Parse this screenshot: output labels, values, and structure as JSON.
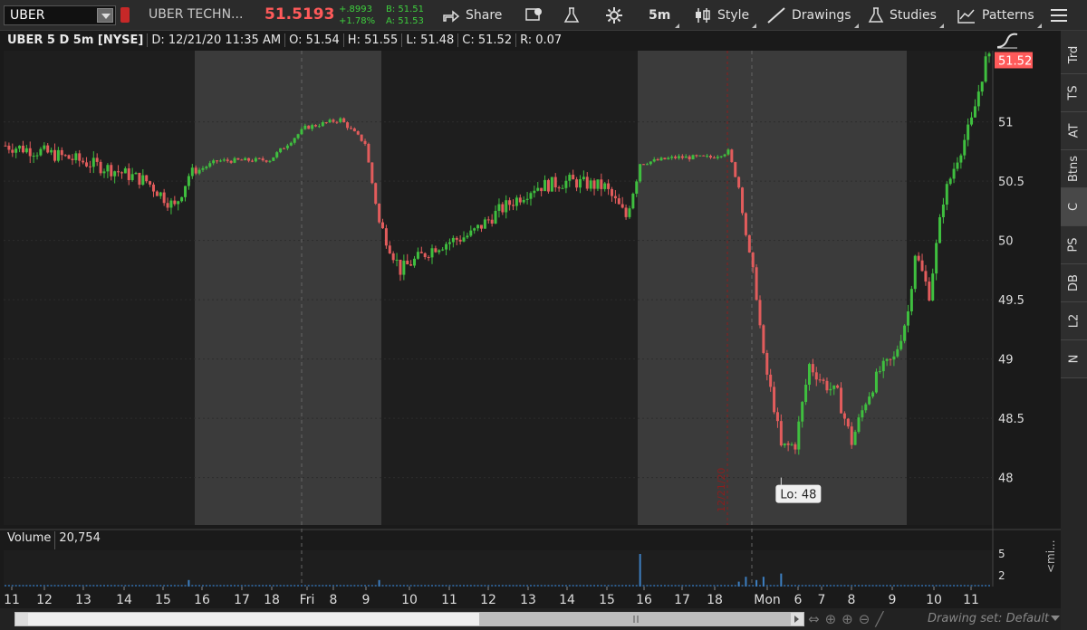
{
  "toolbar": {
    "symbol": "UBER",
    "company": "UBER TECHN...",
    "last_price": "51.5193",
    "net_change": "+.8993",
    "pct_change": "+1.78%",
    "bid": "B: 51.51",
    "ask": "A: 51.53",
    "share_label": "Share",
    "timeframe_label": "5m",
    "style_label": "Style",
    "drawings_label": "Drawings",
    "studies_label": "Studies",
    "patterns_label": "Patterns"
  },
  "infobar": {
    "title": "UBER 5 D 5m [NYSE]",
    "date": "D: 12/21/20 11:35 AM",
    "open": "O: 51.54",
    "high": "H: 51.55",
    "low": "L: 51.48",
    "close": "C: 51.52",
    "range": "R: 0.07"
  },
  "volume": {
    "label": "Volume",
    "value": "20,754",
    "axis_ticks": [
      "5",
      "2"
    ]
  },
  "right_tabs": [
    "Trd",
    "TS",
    "AT",
    "Btns",
    "C",
    "PS",
    "DB",
    "L2",
    "N"
  ],
  "mi_tab": "<mi...",
  "bottom": {
    "drawing_set": "Drawing set: Default"
  },
  "colors": {
    "up": "#3fbf3f",
    "down": "#e25c5c",
    "background": "#1a1a1a",
    "extended_hours": "#3b3b3b",
    "price_tag": "#ff5a5a"
  },
  "chart_data": {
    "type": "candlestick",
    "symbol": "UBER",
    "ylim": [
      47.6,
      51.6
    ],
    "y_ticks": [
      48,
      48.5,
      49,
      49.5,
      50,
      50.5,
      51
    ],
    "x_labels": [
      "11",
      "12",
      "13",
      "14",
      "15",
      "16",
      "17",
      "18",
      "Fri",
      "8",
      "9",
      "10",
      "11",
      "12",
      "13",
      "14",
      "15",
      "16",
      "17",
      "18",
      "Mon",
      "6",
      "7",
      "8",
      "9",
      "10",
      "11"
    ],
    "last_price_tag": "51.52",
    "low_annotation": "Lo: 48",
    "date_marker": "12/21/20",
    "shaded_sessions": [
      "16-18 (prev day ext.)",
      "Fri pre-market",
      "16-18 (Fri ext.)",
      "Mon pre-market"
    ],
    "path_points": [
      {
        "i": 0,
        "p": 50.8
      },
      {
        "i": 10,
        "p": 50.75
      },
      {
        "i": 20,
        "p": 50.68
      },
      {
        "i": 30,
        "p": 50.6
      },
      {
        "i": 40,
        "p": 50.5
      },
      {
        "i": 48,
        "p": 50.28
      },
      {
        "i": 52,
        "p": 50.55
      },
      {
        "i": 60,
        "p": 50.67
      },
      {
        "i": 75,
        "p": 50.68
      },
      {
        "i": 85,
        "p": 50.95
      },
      {
        "i": 95,
        "p": 51.02
      },
      {
        "i": 102,
        "p": 50.82
      },
      {
        "i": 106,
        "p": 50.15
      },
      {
        "i": 112,
        "p": 49.75
      },
      {
        "i": 122,
        "p": 49.95
      },
      {
        "i": 132,
        "p": 50.05
      },
      {
        "i": 140,
        "p": 50.25
      },
      {
        "i": 150,
        "p": 50.45
      },
      {
        "i": 160,
        "p": 50.5
      },
      {
        "i": 170,
        "p": 50.45
      },
      {
        "i": 176,
        "p": 50.2
      },
      {
        "i": 180,
        "p": 50.65
      },
      {
        "i": 190,
        "p": 50.7
      },
      {
        "i": 200,
        "p": 50.7
      },
      {
        "i": 205,
        "p": 50.75
      },
      {
        "i": 208,
        "p": 50.45
      },
      {
        "i": 210,
        "p": 50.05
      },
      {
        "i": 213,
        "p": 49.55
      },
      {
        "i": 215,
        "p": 49.0
      },
      {
        "i": 218,
        "p": 48.6
      },
      {
        "i": 220,
        "p": 48.25
      },
      {
        "i": 224,
        "p": 48.28
      },
      {
        "i": 228,
        "p": 48.95
      },
      {
        "i": 232,
        "p": 48.8
      },
      {
        "i": 236,
        "p": 48.7
      },
      {
        "i": 240,
        "p": 48.3
      },
      {
        "i": 244,
        "p": 48.65
      },
      {
        "i": 248,
        "p": 48.9
      },
      {
        "i": 252,
        "p": 49.0
      },
      {
        "i": 256,
        "p": 49.4
      },
      {
        "i": 258,
        "p": 49.9
      },
      {
        "i": 262,
        "p": 49.55
      },
      {
        "i": 266,
        "p": 50.35
      },
      {
        "i": 270,
        "p": 50.7
      },
      {
        "i": 274,
        "p": 51.0
      },
      {
        "i": 278,
        "p": 51.52
      }
    ],
    "volume_spikes": [
      {
        "i": 52,
        "v": 0.2
      },
      {
        "i": 106,
        "v": 0.2
      },
      {
        "i": 180,
        "v": 1.0
      },
      {
        "i": 208,
        "v": 0.15
      },
      {
        "i": 210,
        "v": 0.3
      },
      {
        "i": 213,
        "v": 0.2
      },
      {
        "i": 215,
        "v": 0.3
      },
      {
        "i": 220,
        "v": 0.4
      }
    ]
  }
}
